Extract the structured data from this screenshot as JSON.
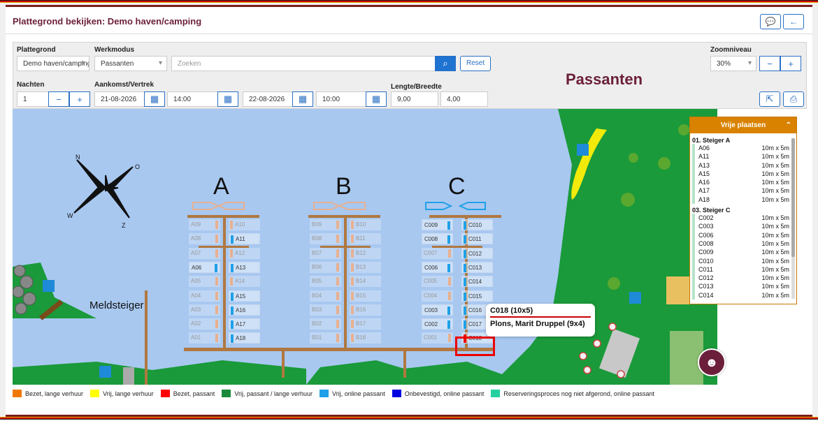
{
  "header": {
    "title": "Plattegrond bekijken: Demo haven/camping",
    "chat_icon": "comment-icon",
    "back_icon": "arrow-left-icon"
  },
  "filters": {
    "plattegrond_label": "Plattegrond",
    "plattegrond_value": "Demo haven/camping",
    "werkmodus_label": "Werkmodus",
    "werkmodus_value": "Passanten",
    "search_placeholder": "Zoeken",
    "reset_label": "Reset",
    "zoom_label": "Zoomniveau",
    "zoom_value": "30%",
    "nachten_label": "Nachten",
    "nachten_value": "1",
    "aankomst_label": "Aankomst/Vertrek",
    "arrival_date": "21-08-2026",
    "arrival_time": "14:00",
    "departure_date": "22-08-2026",
    "departure_time": "10:00",
    "lb_label": "Lengte/Breedte",
    "length": "9,00",
    "width": "4,00"
  },
  "mode_title": "Passanten",
  "map": {
    "meldsteiger": "Meldsteiger",
    "piers": [
      {
        "name": "A",
        "left": [
          "A09",
          "A08",
          "A07",
          "A06",
          "A05",
          "A04",
          "A03",
          "A02",
          "A01"
        ],
        "right": [
          "A10",
          "A11",
          "A12",
          "A13",
          "A14",
          "A15",
          "A16",
          "A17",
          "A18"
        ]
      },
      {
        "name": "B",
        "left": [
          "B09",
          "B08",
          "B07",
          "B06",
          "B05",
          "B04",
          "B03",
          "B02",
          "B01"
        ],
        "right": [
          "B10",
          "B11",
          "B12",
          "B13",
          "B14",
          "B15",
          "B16",
          "B17",
          "B18"
        ]
      },
      {
        "name": "C",
        "left": [
          "C009",
          "C008",
          "C007",
          "C006",
          "C005",
          "C004",
          "C003",
          "C002",
          "C001"
        ],
        "right": [
          "C010",
          "C011",
          "C012",
          "C013",
          "C014",
          "C015",
          "C016",
          "C017",
          "C018"
        ]
      }
    ],
    "tooltip": {
      "line1": "C018 (10x5)",
      "line2": "Plons, Marit Druppel (9x4)"
    }
  },
  "free_places": {
    "title": "Vrije plaatsen",
    "groups": [
      {
        "name": "01. Steiger A",
        "items": [
          [
            "A06",
            "10m x 5m"
          ],
          [
            "A11",
            "10m x 5m"
          ],
          [
            "A13",
            "10m x 5m"
          ],
          [
            "A15",
            "10m x 5m"
          ],
          [
            "A16",
            "10m x 5m"
          ],
          [
            "A17",
            "10m x 5m"
          ],
          [
            "A18",
            "10m x 5m"
          ]
        ]
      },
      {
        "name": "03. Steiger C",
        "items": [
          [
            "C002",
            "10m x 5m"
          ],
          [
            "C003",
            "10m x 5m"
          ],
          [
            "C006",
            "10m x 5m"
          ],
          [
            "C008",
            "10m x 5m"
          ],
          [
            "C009",
            "10m x 5m"
          ],
          [
            "C010",
            "10m x 5m"
          ],
          [
            "C011",
            "10m x 5m"
          ],
          [
            "C012",
            "10m x 5m"
          ],
          [
            "C013",
            "10m x 5m"
          ],
          [
            "C014",
            "10m x 5m"
          ]
        ]
      }
    ]
  },
  "legend": [
    {
      "label": "Bezet, lange verhuur",
      "color": "#f07800"
    },
    {
      "label": "Vrij, lange verhuur",
      "color": "#ffff00"
    },
    {
      "label": "Bezet, passant",
      "color": "#ff0000"
    },
    {
      "label": "Vrij, passant / lange verhuur",
      "color": "#1a8a3a"
    },
    {
      "label": "Vrij, online passant",
      "color": "#1fa0e8"
    },
    {
      "label": "Onbevestigd, online passant",
      "color": "#0000e0"
    },
    {
      "label": "Reserveringsproces nog niet afgerond, online passant",
      "color": "#22d0a0"
    }
  ]
}
